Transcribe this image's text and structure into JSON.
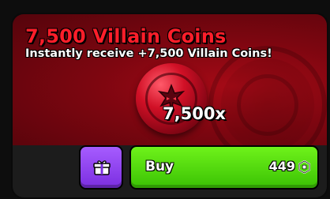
{
  "offer": {
    "title": "7,500 Villain Coins",
    "description": "Instantly receive +7,500 Villain Coins!",
    "quantity_label": "7,500x",
    "coin_icon": "villain-coin-icon"
  },
  "actions": {
    "gift_icon": "gift-icon",
    "buy_label": "Buy",
    "price": "449",
    "currency_icon": "robux-icon"
  },
  "colors": {
    "title": "#ff1e2a",
    "banner": "#7d0610",
    "gift_button": "#8f44f0",
    "buy_button": "#4fd40c"
  }
}
